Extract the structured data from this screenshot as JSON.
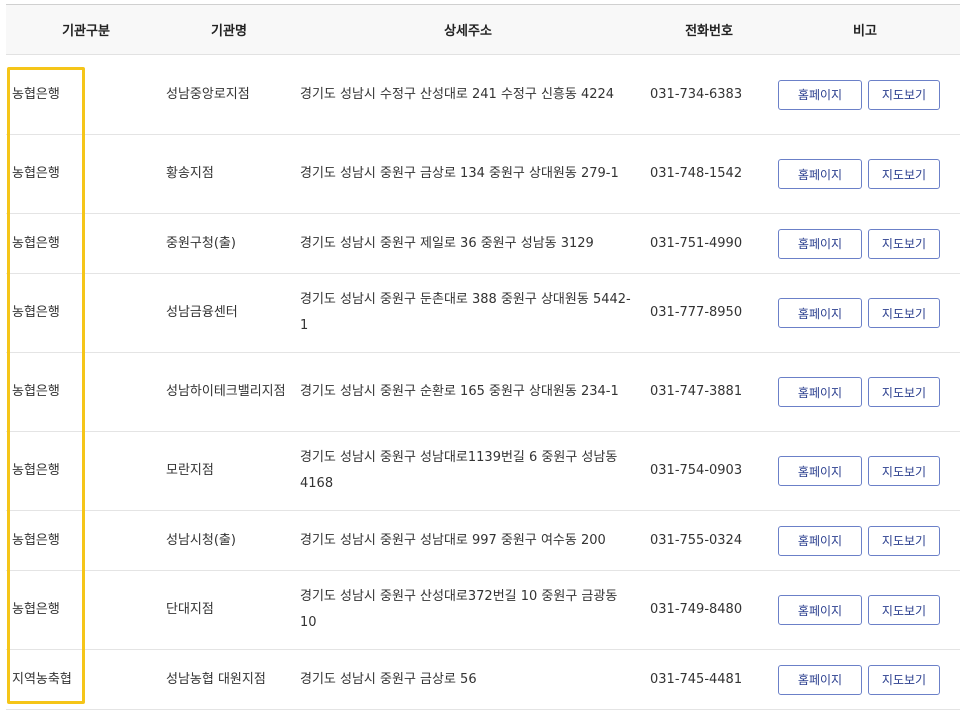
{
  "columns": {
    "type": "기관구분",
    "name": "기관명",
    "address": "상세주소",
    "phone": "전화번호",
    "note": "비고"
  },
  "buttons": {
    "homepage": "홈페이지",
    "map": "지도보기"
  },
  "highlight_color": "#f5c518",
  "rows": [
    {
      "type": "농협은행",
      "name": "성남중앙로지점",
      "address": "경기도 성남시 수정구 산성대로 241 수정구 신흥동 4224",
      "phone": "031-734-6383"
    },
    {
      "type": "농협은행",
      "name": "황송지점",
      "address": "경기도 성남시 중원구 금상로 134 중원구 상대원동 279-1",
      "phone": "031-748-1542"
    },
    {
      "type": "농협은행",
      "name": "중원구청(출)",
      "address": "경기도 성남시 중원구 제일로 36 중원구 성남동 3129",
      "phone": "031-751-4990"
    },
    {
      "type": "농협은행",
      "name": "성남금융센터",
      "address": "경기도 성남시 중원구 둔촌대로 388 중원구 상대원동 5442-1",
      "phone": "031-777-8950"
    },
    {
      "type": "농협은행",
      "name": "성남하이테크밸리지점",
      "address": "경기도 성남시 중원구 순환로 165 중원구 상대원동 234-1",
      "phone": "031-747-3881"
    },
    {
      "type": "농협은행",
      "name": "모란지점",
      "address": "경기도 성남시 중원구 성남대로1139번길 6 중원구 성남동 4168",
      "phone": "031-754-0903"
    },
    {
      "type": "농협은행",
      "name": "성남시청(출)",
      "address": "경기도 성남시 중원구 성남대로 997 중원구 여수동 200",
      "phone": "031-755-0324"
    },
    {
      "type": "농협은행",
      "name": "단대지점",
      "address": "경기도 성남시 중원구 산성대로372번길 10 중원구 금광동 10",
      "phone": "031-749-8480"
    },
    {
      "type": "지역농축협",
      "name": "성남농협 대원지점",
      "address": "경기도 성남시 중원구 금상로 56",
      "phone": "031-745-4481"
    }
  ]
}
